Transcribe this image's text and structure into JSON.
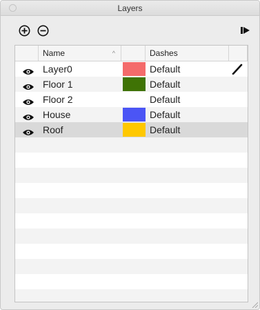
{
  "window": {
    "title": "Layers"
  },
  "toolbar": {
    "add_icon": "circle-plus-icon",
    "remove_icon": "circle-minus-icon",
    "details_icon": "arrow-right-icon"
  },
  "columns": {
    "name": "Name",
    "dashes": "Dashes",
    "sort_glyph": "^"
  },
  "layers": [
    {
      "name": "Layer0",
      "color": "#f46b6b",
      "dashes": "Default",
      "active": true
    },
    {
      "name": "Floor 1",
      "color": "#3f7305",
      "dashes": "Default",
      "active": false
    },
    {
      "name": "Floor 2",
      "color": "",
      "dashes": "Default",
      "active": false
    },
    {
      "name": "House",
      "color": "#4b55f5",
      "dashes": "Default",
      "active": false
    },
    {
      "name": "Roof",
      "color": "#ffc800",
      "dashes": "Default",
      "active": false,
      "selected": true
    }
  ],
  "empty_rows": 11
}
